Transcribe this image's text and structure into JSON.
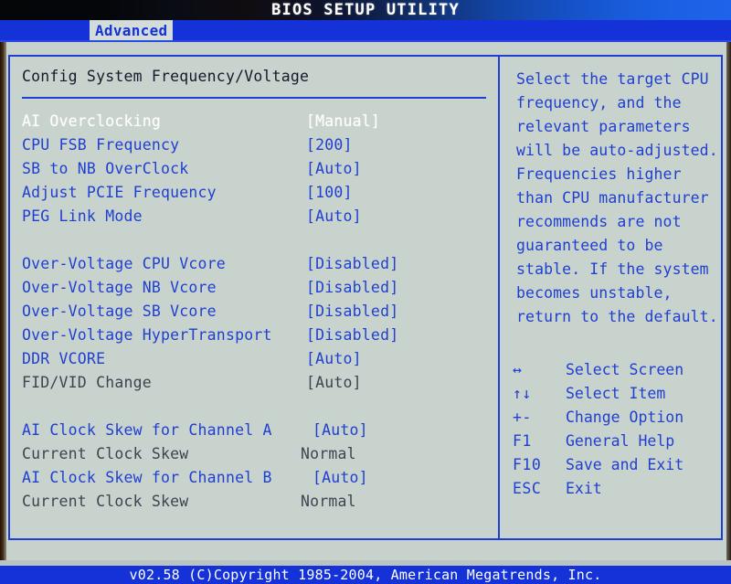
{
  "banner": {
    "title": "BIOS SETUP UTILITY"
  },
  "tabs": [
    {
      "label": "Advanced",
      "active": true
    }
  ],
  "left_pane": {
    "section_title": "Config System Frequency/Voltage",
    "rows": [
      {
        "label": "AI Overclocking",
        "value": "[Manual]",
        "style": "selected",
        "value_style": "bracket"
      },
      {
        "label": "CPU FSB Frequency",
        "value": "[200]",
        "style": "option",
        "value_style": "bracket"
      },
      {
        "label": "SB to NB OverClock",
        "value": "[Auto]",
        "style": "option",
        "value_style": "bracket"
      },
      {
        "label": "Adjust PCIE Frequency",
        "value": "[100]",
        "style": "option",
        "value_style": "bracket"
      },
      {
        "label": "PEG Link Mode",
        "value": "[Auto]",
        "style": "option",
        "value_style": "bracket"
      },
      {
        "label": "",
        "value": "",
        "style": "spacer",
        "value_style": "bracket"
      },
      {
        "label": "Over-Voltage CPU Vcore",
        "value": "[Disabled]",
        "style": "option",
        "value_style": "bracket"
      },
      {
        "label": "Over-Voltage NB Vcore",
        "value": "[Disabled]",
        "style": "option",
        "value_style": "bracket"
      },
      {
        "label": "Over-Voltage SB Vcore",
        "value": "[Disabled]",
        "style": "option",
        "value_style": "bracket"
      },
      {
        "label": "Over-Voltage HyperTransport",
        "value": "[Disabled]",
        "style": "option",
        "value_style": "bracket"
      },
      {
        "label": "DDR VCORE",
        "value": "[Auto]",
        "style": "option",
        "value_style": "bracket"
      },
      {
        "label": "FID/VID Change",
        "value": "[Auto]",
        "style": "readonly",
        "value_style": "bracket"
      },
      {
        "label": "",
        "value": "",
        "style": "spacer",
        "value_style": "bracket"
      },
      {
        "label": "AI Clock Skew for Channel A",
        "value": "[Auto]",
        "style": "option",
        "value_style": "indent"
      },
      {
        "label": "Current Clock Skew",
        "value": "Normal",
        "style": "readonly",
        "value_style": "plain"
      },
      {
        "label": "AI Clock Skew for Channel B",
        "value": "[Auto]",
        "style": "option",
        "value_style": "indent"
      },
      {
        "label": "Current Clock Skew",
        "value": "Normal",
        "style": "readonly",
        "value_style": "plain"
      }
    ]
  },
  "right_pane": {
    "help_lines": [
      "Select the target CPU",
      "frequency, and the",
      "relevant parameters",
      "will be auto-adjusted.",
      "Frequencies higher",
      "than CPU manufacturer",
      "recommends are not",
      "guaranteed to be",
      "stable. If the system",
      "becomes unstable,",
      "return to the default."
    ],
    "legend": [
      {
        "key": "↔",
        "action": "Select Screen",
        "icon": "left-right-arrow-icon"
      },
      {
        "key": "↑↓",
        "action": "Select Item",
        "icon": "up-down-arrow-icon"
      },
      {
        "key": "+-",
        "action": "Change Option",
        "icon": "plus-minus-icon"
      },
      {
        "key": "F1",
        "action": "General Help",
        "icon": "f1-key-icon"
      },
      {
        "key": "F10",
        "action": "Save and Exit",
        "icon": "f10-key-icon"
      },
      {
        "key": "ESC",
        "action": "Exit",
        "icon": "esc-key-icon"
      }
    ]
  },
  "footer": {
    "text": "v02.58 (C)Copyright 1985-2004, American Megatrends, Inc."
  },
  "colors": {
    "accent_blue": "#1f3fd0",
    "banner_blue": "#1432d8",
    "screen_bg": "#c8d2cd",
    "selected_text": "#ffffff",
    "readonly_text": "#3d4450",
    "title_text": "#131a2b"
  }
}
